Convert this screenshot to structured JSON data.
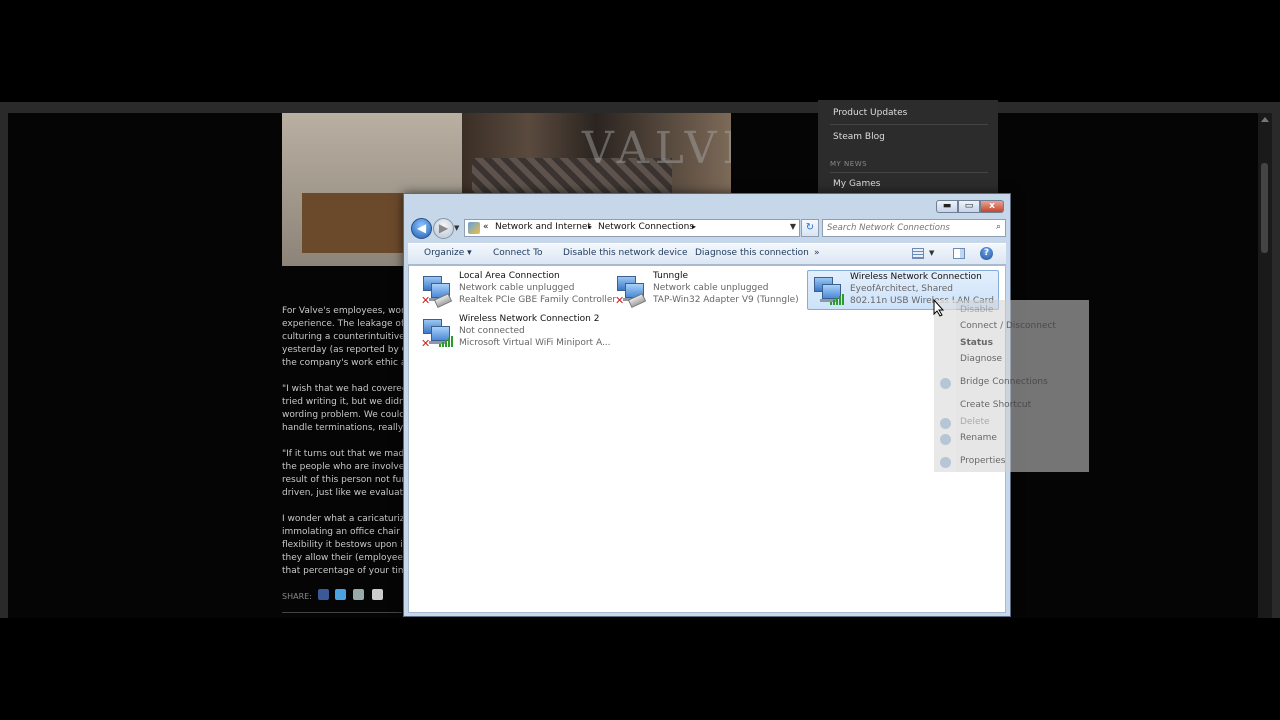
{
  "background_page": {
    "article_text": [
      "For Valve's employees, worki",
      "experience. The leakage of Va",
      "culturing a counterintuitive en",
      "yesterday (as reported by Gee",
      "the company's work ethic also",
      "\"I wish that we had covered fir",
      "tried writing it, but we didn't fe",
      "wording problem. We couldn'",
      "handle terminations, really, is",
      "\"If it turns out that we made a",
      "the people who are involved i",
      "result of this person not functi",
      "driven, just like we evaluate e",
      "I wonder what a caricaturized",
      "immolating an office chair or",
      "flexibility it bestows upon its v",
      "they allow their (employees) t",
      "that percentage of your time is"
    ],
    "share_label": "SHARE:",
    "photo_logo": "VALVE",
    "right_panel": {
      "product_updates": "Product Updates",
      "steam_blog": "Steam Blog",
      "my_news_heading": "MY NEWS",
      "my_games": "My Games"
    }
  },
  "window": {
    "caption": {
      "minimize": "▬",
      "maximize": "▭",
      "close": "x"
    },
    "nav": {
      "back": "◀",
      "forward": "▶",
      "refresh": "↻"
    },
    "breadcrumb": {
      "overflow": "«",
      "items": [
        "Network and Internet",
        "Network Connections"
      ],
      "separator": "▸",
      "dropdown": "▼"
    },
    "search": {
      "placeholder": "Search Network Connections",
      "icon": "search-icon"
    },
    "toolbar": {
      "organize": "Organize ▾",
      "connect_to": "Connect To",
      "disable_device": "Disable this network device",
      "diagnose": "Diagnose this connection",
      "more": "»",
      "help": "?"
    },
    "connections": [
      {
        "name": "Local Area Connection",
        "status": "Network cable unplugged",
        "device": "Realtek PCIe GBE Family Controller",
        "kind": "wired",
        "disconnected": true,
        "selected": false
      },
      {
        "name": "Tunngle",
        "status": "Network cable unplugged",
        "device": "TAP-Win32 Adapter V9 (Tunngle)",
        "kind": "wired",
        "disconnected": true,
        "selected": false
      },
      {
        "name": "Wireless Network Connection",
        "status": "EyeofArchitect, Shared",
        "device": "802.11n USB Wireless LAN Card",
        "kind": "wireless",
        "disconnected": false,
        "selected": true
      },
      {
        "name": "Wireless Network Connection 2",
        "status": "Not connected",
        "device": "Microsoft Virtual WiFi Miniport A...",
        "kind": "wireless",
        "disconnected": true,
        "selected": false
      }
    ]
  },
  "context_menu": {
    "items": [
      {
        "label": "Disable",
        "state": "disabled"
      },
      {
        "label": "Connect / Disconnect",
        "state": "normal"
      },
      {
        "label": "Status",
        "state": "bold"
      },
      {
        "label": "Diagnose",
        "state": "normal"
      },
      {
        "label": "Bridge Connections",
        "state": "normal"
      },
      {
        "label": "Create Shortcut",
        "state": "normal"
      },
      {
        "label": "Delete",
        "state": "disabled"
      },
      {
        "label": "Rename",
        "state": "normal"
      },
      {
        "label": "Properties",
        "state": "normal"
      }
    ]
  },
  "colors": {
    "window_frame": "#c7d7ea",
    "toolbar_text": "#1e395b",
    "selection": "#cde2fa",
    "error_red": "#d21f1f",
    "signal_green": "#2e9a2e"
  }
}
